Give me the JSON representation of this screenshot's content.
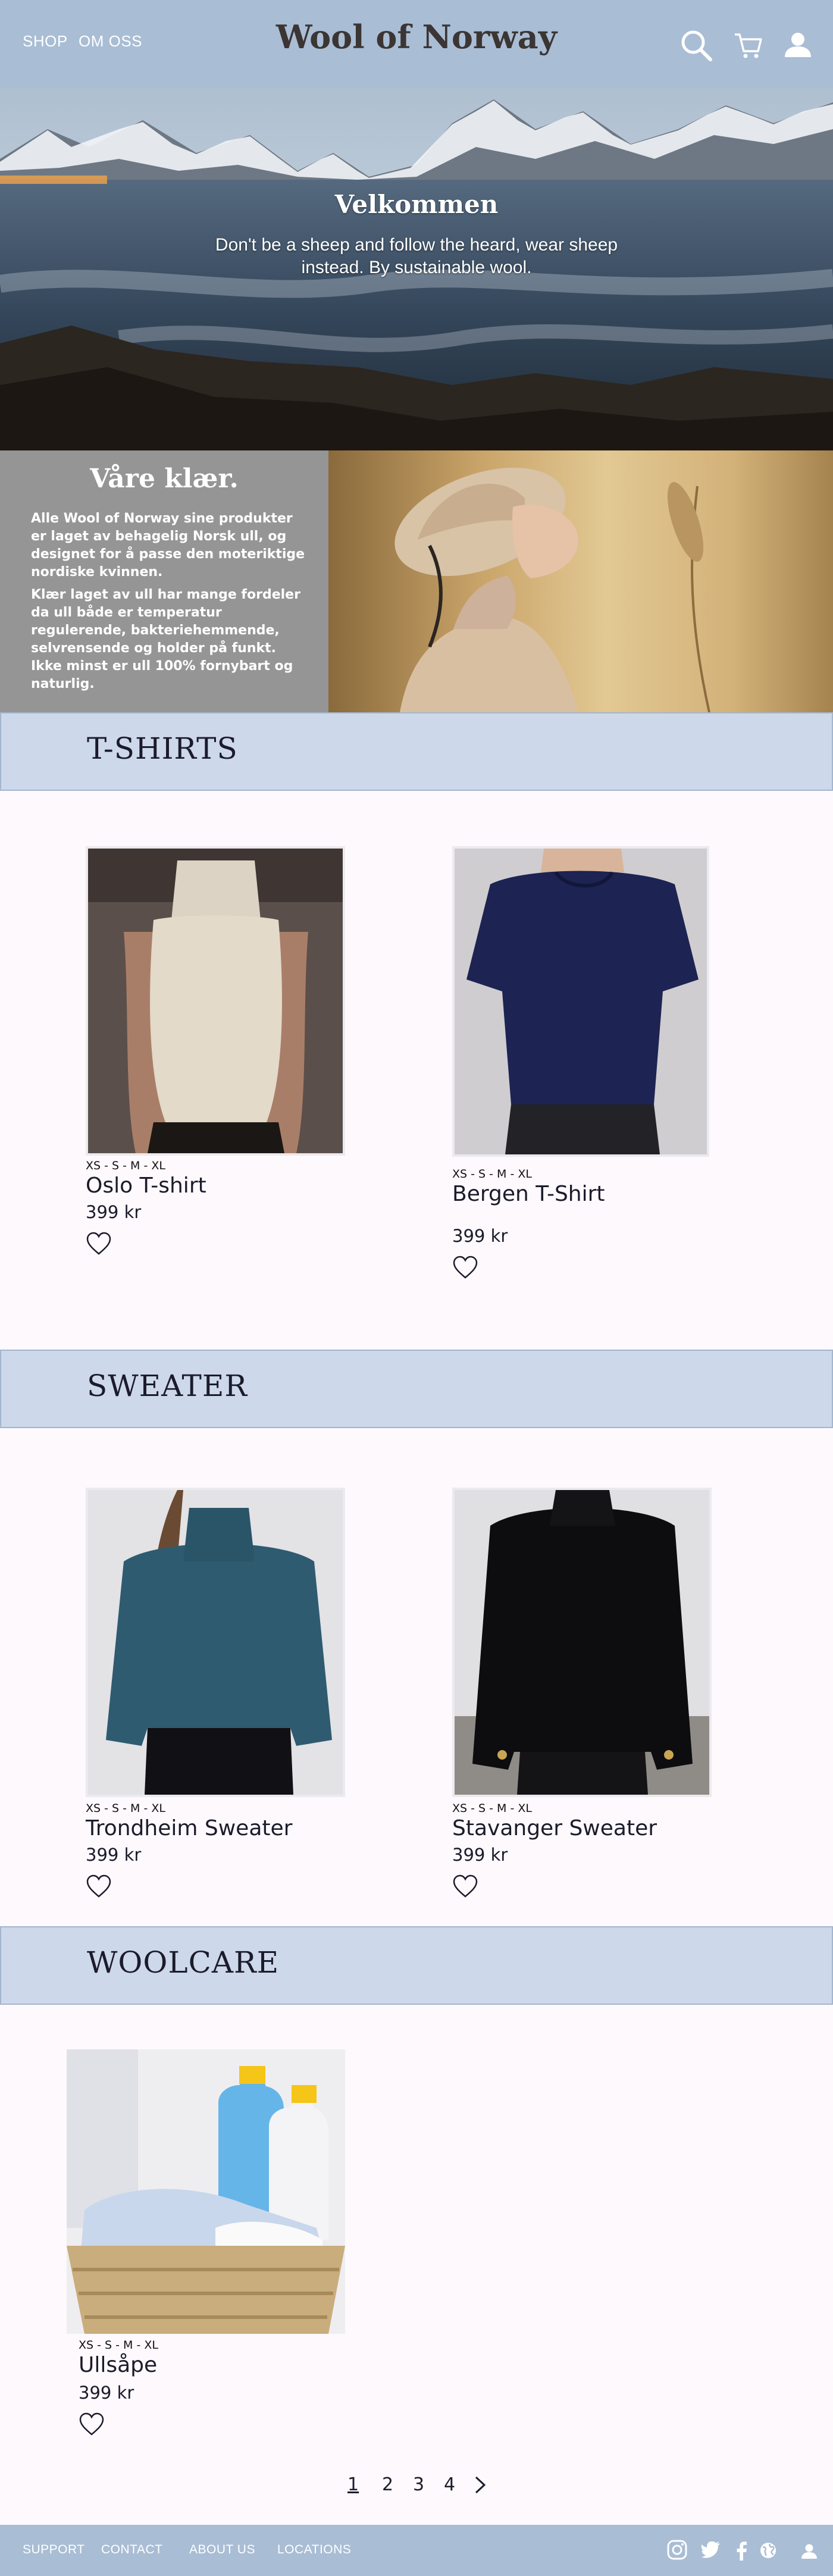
{
  "header": {
    "nav": [
      {
        "label": "SHOP"
      },
      {
        "label": "OM OSS"
      }
    ],
    "brand": "Wool of Norway",
    "icons": [
      "search-icon",
      "cart-icon",
      "user-icon"
    ]
  },
  "hero": {
    "title": "Velkommen",
    "text": "Don't be a sheep and follow the heard, wear sheep instead. By sustainable wool."
  },
  "about": {
    "title": "Våre klær.",
    "paragraph_1": "Alle Wool of Norway sine produkter er laget av behagelig Norsk ull, og designet for å passe den moteriktige nordiske kvinnen.",
    "paragraph_2": "Klær laget av ull har mange fordeler da ull både er temperatur regulerende, bakteriehemmende, selvrensende og holder på funkt. Ikke minst er ull 100% fornybart og naturlig."
  },
  "sections": [
    {
      "title": "T-SHIRTS",
      "products": [
        {
          "sizes": "XS - S - M - XL",
          "name": "Oslo T-shirt",
          "price": "399 kr",
          "image": "cream-knit-top"
        },
        {
          "sizes": "XS - S - M - XL",
          "name": "Bergen T-Shirt",
          "price": "399 kr",
          "image": "navy-knit-tee"
        }
      ]
    },
    {
      "title": "SWEATER",
      "products": [
        {
          "sizes": "XS - S - M - XL",
          "name": "Trondheim Sweater",
          "price": "399 kr",
          "image": "teal-chunky-sweater"
        },
        {
          "sizes": "XS - S - M - XL",
          "name": "Stavanger Sweater",
          "price": "399 kr",
          "image": "black-knit-sweater"
        }
      ]
    },
    {
      "title": "WOOLCARE",
      "products": [
        {
          "sizes": "XS - S - M - XL",
          "name": "Ullsåpe",
          "price": "399 kr",
          "image": "detergent-laundry-basket"
        }
      ]
    }
  ],
  "pagination": {
    "pages": [
      "1",
      "2",
      "3",
      "4"
    ],
    "current": "1",
    "next_icon": "chevron-right-icon"
  },
  "footer": {
    "links": [
      {
        "label": "SUPPORT"
      },
      {
        "label": "CONTACT"
      },
      {
        "label": "ABOUT US"
      },
      {
        "label": "LOCATIONS"
      }
    ],
    "icons": [
      "instagram-icon",
      "twitter-icon",
      "facebook-icon",
      "globe-icon",
      "user-icon"
    ]
  },
  "colors": {
    "header_bg": "#a9bdd5",
    "section_bg": "#cdd8ea",
    "about_bg": "#959595",
    "page_bg": "#fdf9fd"
  }
}
